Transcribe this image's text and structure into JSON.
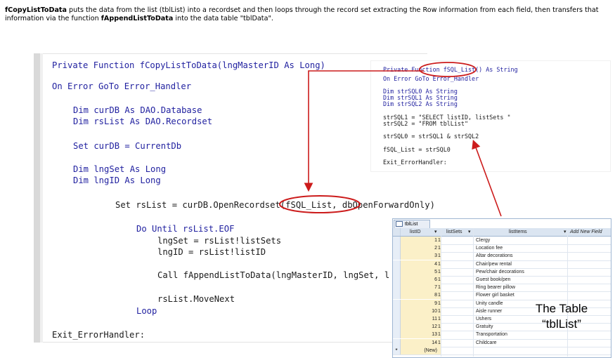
{
  "intro": {
    "func1": "fCopyListToData",
    "part1": " puts the data from the list (tblList) into a recordset and then loops through the record set extracting the Row information from each field, then transfers that information via the function ",
    "func2": "fAppendListToData",
    "part2": " into the data table \"tblData\"."
  },
  "main_code": {
    "l1_kw": "Private Function",
    "l1_rest": " fCopyListToData(lngMasterID As Long)",
    "l2": "On Error GoTo Error_Handler",
    "l3": "Dim curDB As DAO.Database",
    "l4": "Dim rsList As DAO.Recordset",
    "l5": "Set curDB = CurrentDb",
    "l6": "Dim lngSet As Long",
    "l7": "Dim lngID As Long",
    "l8a": "Set rsList = curDB.OpenRecordset(",
    "l8b": "fSQL_List,",
    "l8c": " dbOpenForwardOnly)",
    "l9": "Do Until rsList.EOF",
    "l10": "lngSet = rsList!listSets",
    "l11": "lngID = rsList!listID",
    "l12": "Call fAppendListToData(lngMasterID, lngSet, l",
    "l13": "rsList.MoveNext",
    "l14": "Loop",
    "l15": "Exit_ErrorHandler:"
  },
  "side_code": {
    "s1a": "Private Functi",
    "s1b": "on fSQL_List() ",
    "s1c": "As String",
    "s2": "On Error GoTo Error_Handler",
    "s3": "Dim strSQL0 As String",
    "s4": "Dim strSQL1 As String",
    "s5": "Dim strSQL2 As String",
    "s6": "strSQL1 = \"SELECT listID, listSets \"",
    "s7": "strSQL2 = \"FROM tblList\"",
    "s8": "strSQL0 = strSQL1 & strSQL2",
    "s9": "fSQL_List = strSQL0",
    "s10": "Exit_ErrorHandler:"
  },
  "table": {
    "tab_name": "tblList",
    "columns": [
      "listID",
      "listSets",
      "listItems",
      "Add New Field"
    ],
    "rows": [
      {
        "id": "1",
        "sets": "1",
        "item": "Clergy"
      },
      {
        "id": "2",
        "sets": "1",
        "item": "Location fee"
      },
      {
        "id": "3",
        "sets": "1",
        "item": "Altar decorations"
      },
      {
        "id": "4",
        "sets": "1",
        "item": "Chair/pew rental"
      },
      {
        "id": "5",
        "sets": "1",
        "item": "Pew/chair decorations"
      },
      {
        "id": "6",
        "sets": "1",
        "item": "Guest book/pen"
      },
      {
        "id": "7",
        "sets": "1",
        "item": "Ring bearer pillow"
      },
      {
        "id": "8",
        "sets": "1",
        "item": "Flower girl basket"
      },
      {
        "id": "9",
        "sets": "1",
        "item": "Unity candle"
      },
      {
        "id": "10",
        "sets": "1",
        "item": "Aisle runner"
      },
      {
        "id": "11",
        "sets": "1",
        "item": "Ushers"
      },
      {
        "id": "12",
        "sets": "1",
        "item": "Gratuity"
      },
      {
        "id": "13",
        "sets": "1",
        "item": "Transportation"
      },
      {
        "id": "14",
        "sets": "1",
        "item": "Childcare"
      }
    ],
    "new_row": "(New)",
    "new_marker": "*"
  },
  "caption": {
    "line1": "The Table",
    "line2": "“tblList”"
  },
  "colors": {
    "keyword": "#1f1f9f",
    "annotation_red": "#cc1b1b"
  }
}
